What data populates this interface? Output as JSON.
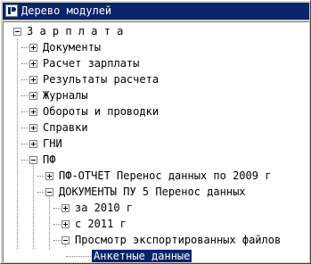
{
  "window": {
    "title": "Дерево модулей"
  },
  "tree": {
    "root": "З а р п л а т а",
    "items": [
      "Документы",
      "Расчет зарплаты",
      "Результаты расчета",
      "Журналы",
      "Обороты и проводки",
      "Справки",
      "ГНИ",
      "ПФ"
    ],
    "pf_children": [
      "ПФ-ОТЧЕТ Перенос данных по 2009 г",
      "ДОКУМЕНТЫ ПУ 5 Перенос данных"
    ],
    "pu5_children": [
      "за 2010 г",
      "с 2011 г",
      "Просмотр экспортированных файлов"
    ],
    "view_children": [
      "Анкетные данные"
    ]
  }
}
